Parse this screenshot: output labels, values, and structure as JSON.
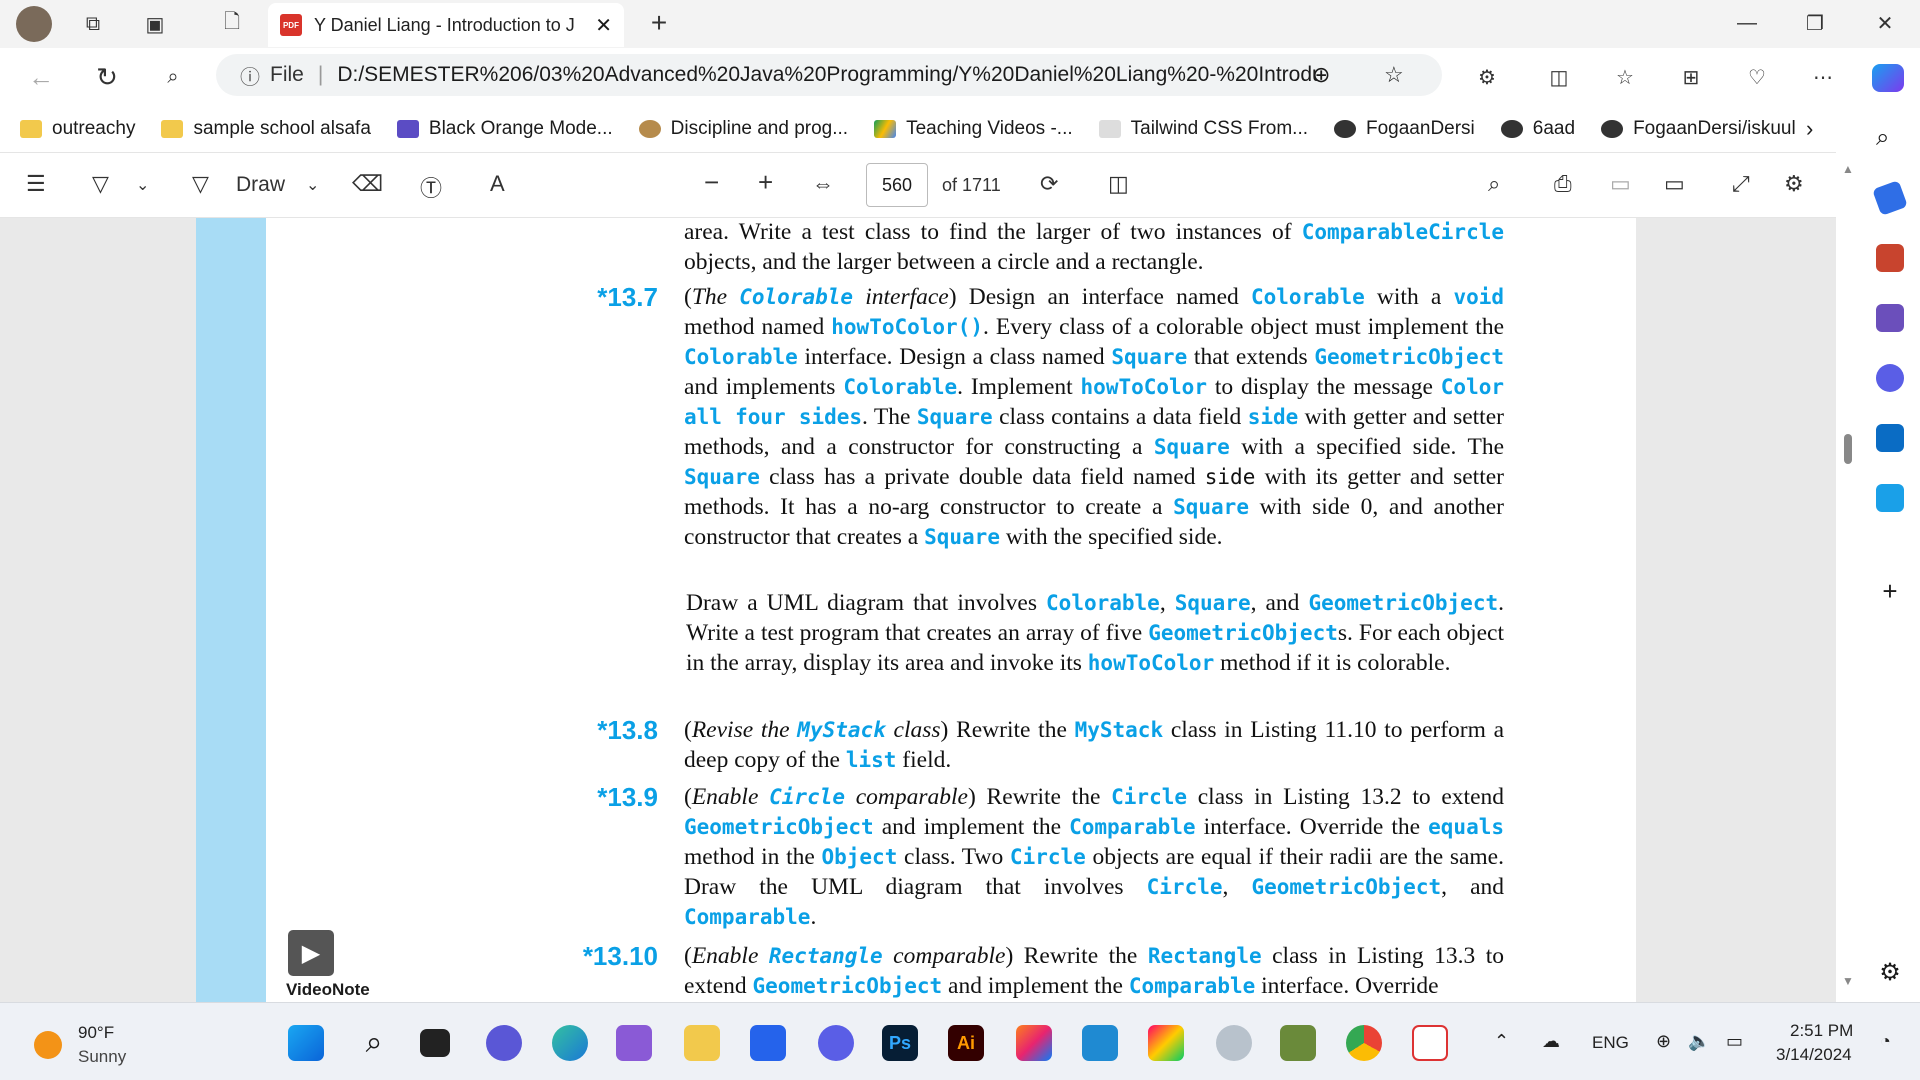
{
  "browser": {
    "tab_title": "Y Daniel Liang - Introduction to J",
    "address_file_label": "File",
    "address_url": "D:/SEMESTER%206/03%20Advanced%20Java%20Programming/Y%20Daniel%20Liang%20-%20Introdu...",
    "bookmarks": [
      "outreachy",
      "sample school alsafa",
      "Black Orange Mode...",
      "Discipline and prog...",
      "Teaching Videos -...",
      "Tailwind CSS From...",
      "FogaanDersi",
      "6aad",
      "FogaanDersi/iskuul"
    ]
  },
  "pdf_toolbar": {
    "draw_label": "Draw",
    "page_number": "560",
    "page_total": "of 1711"
  },
  "document": {
    "ex_13_7": "*13.7",
    "ex_13_8": "*13.8",
    "ex_13_9": "*13.9",
    "ex_13_10": "*13.10",
    "videonote": "VideoNote"
  },
  "taskbar": {
    "weather_temp": "90°F",
    "weather_desc": "Sunny",
    "lang": "ENG",
    "time": "2:51 PM",
    "date": "3/14/2024"
  }
}
